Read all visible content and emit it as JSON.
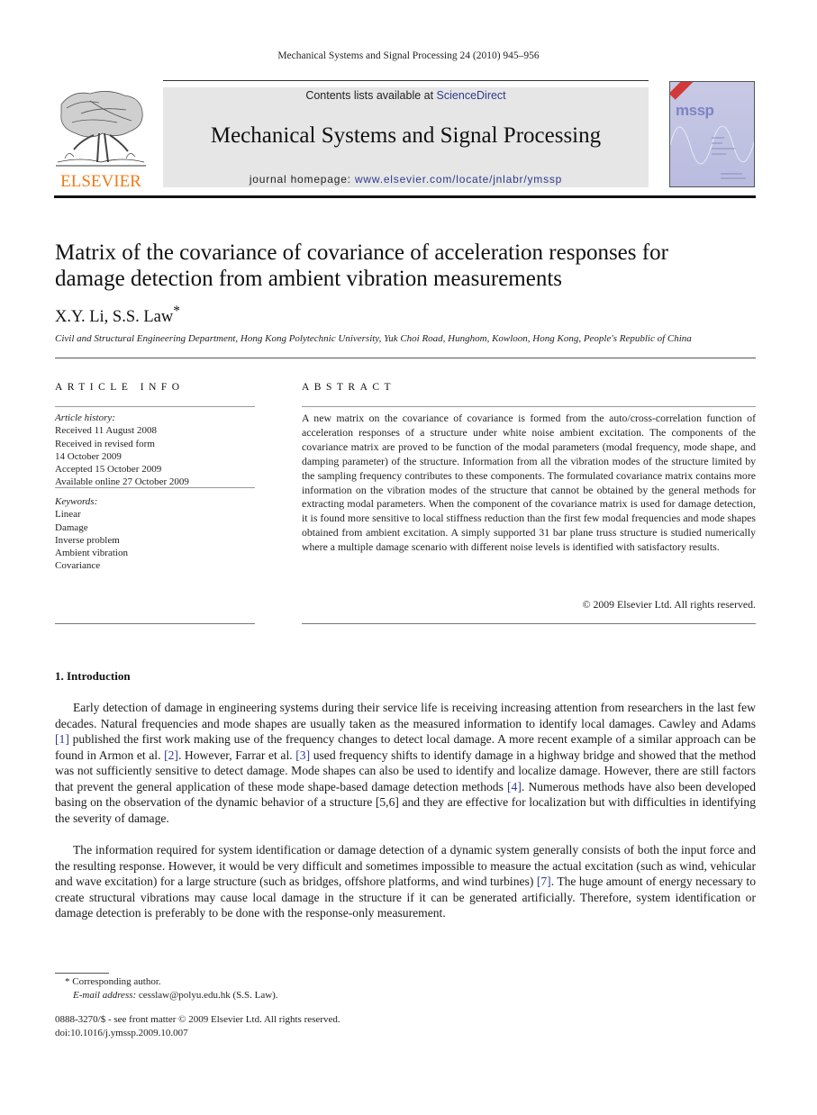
{
  "running_head": "Mechanical Systems and Signal Processing 24 (2010) 945–956",
  "banner": {
    "contents_prefix": "Contents lists available at ",
    "contents_link": "ScienceDirect",
    "journal_title": "Mechanical Systems and Signal Processing",
    "homepage_prefix": "journal homepage: ",
    "homepage_link": "www.elsevier.com/locate/jnlabr/ymssp",
    "publisher_logo_text": "ELSEVIER",
    "cover_text": "mssp"
  },
  "colors": {
    "link": "#2e3a8c",
    "elsevier_orange": "#f07a1a",
    "banner_bg": "#e6e6e6",
    "cover_bg": "#c7c9e4"
  },
  "article": {
    "title_line1": "Matrix of the covariance of covariance of acceleration responses for",
    "title_line2": "damage detection from ambient vibration measurements",
    "authors": "X.Y. Li, S.S. Law",
    "author_mark": "*",
    "affiliation": "Civil and Structural Engineering Department, Hong Kong Polytechnic University, Yuk Choi Road, Hunghom, Kowloon, Hong Kong, People's Republic of China"
  },
  "article_info": {
    "heading": "ARTICLE INFO",
    "history_label": "Article history:",
    "history": [
      "Received 11 August 2008",
      "Received in revised form",
      "14 October 2009",
      "Accepted 15 October 2009",
      "Available online 27 October 2009"
    ],
    "keywords_label": "Keywords:",
    "keywords": [
      "Linear",
      "Damage",
      "Inverse problem",
      "Ambient vibration",
      "Covariance"
    ]
  },
  "abstract": {
    "heading": "ABSTRACT",
    "text": "A new matrix on the covariance of covariance is formed from the auto/cross-correlation function of acceleration responses of a structure under white noise ambient excitation. The components of the covariance matrix are proved to be function of the modal parameters (modal frequency, mode shape, and damping parameter) of the structure. Information from all the vibration modes of the structure limited by the sampling frequency contributes to these components. The formulated covariance matrix contains more information on the vibration modes of the structure that cannot be obtained by the general methods for extracting modal parameters. When the component of the covariance matrix is used for damage detection, it is found more sensitive to local stiffness reduction than the first few modal frequencies and mode shapes obtained from ambient excitation. A simply supported 31 bar plane truss structure is studied numerically where a multiple damage scenario with different noise levels is identified with satisfactory results.",
    "copyright": "© 2009 Elsevier Ltd. All rights reserved."
  },
  "introduction": {
    "heading": "1.  Introduction",
    "p1": {
      "s1": "Early detection of damage in engineering systems during their service life is receiving increasing attention from researchers in the last few decades. Natural frequencies and mode shapes are usually taken as the measured information to identify local damages. Cawley and Adams ",
      "c1": "[1]",
      "s2": " published the first work making use of the frequency changes to detect local damage. A more recent example of a similar approach can be found in Armon et al. ",
      "c2": "[2]",
      "s3": ". However, Farrar et al. ",
      "c3": "[3]",
      "s4": " used frequency shifts to identify damage in a highway bridge and showed that the method was not sufficiently sensitive to detect damage. Mode shapes can also be used to identify and localize damage. However, there are still factors that prevent the general application of these mode shape-based damage detection methods ",
      "c4": "[4]",
      "s5": ". Numerous methods have also been developed basing on the observation of the dynamic behavior of a structure [5,6] and they are effective for localization but with difficulties in identifying the severity of damage."
    },
    "p2": {
      "s1": "The information required for system identification or damage detection of a dynamic system generally consists of both the input force and the resulting response. However, it would be very difficult and sometimes impossible to measure the actual excitation (such as wind, vehicular and wave excitation) for a large structure (such as bridges, offshore platforms, and wind turbines) ",
      "c1": "[7]",
      "s2": ". The huge amount of energy necessary to create structural vibrations may cause local damage in the structure if it can be generated artificially. Therefore, system identification or damage detection is preferably to be done with the response-only measurement."
    }
  },
  "footnote": {
    "mark": "*",
    "corresponding": "Corresponding author.",
    "email_label": "E-mail address:",
    "email": "cesslaw@polyu.edu.hk",
    "email_suffix": " (S.S. Law)."
  },
  "front_matter": {
    "issn_line": "0888-3270/$ - see front matter © 2009 Elsevier Ltd. All rights reserved.",
    "doi": "doi:10.1016/j.ymssp.2009.10.007"
  }
}
